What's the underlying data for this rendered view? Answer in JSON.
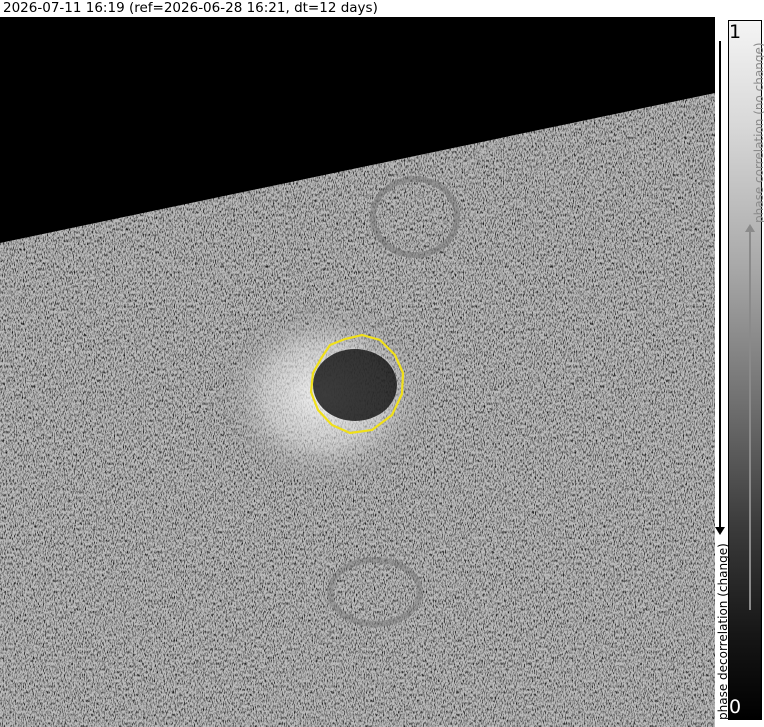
{
  "title": "2026-07-11 16:19 (ref=2026-06-28 16:21, dt=12 days)",
  "colorbar": {
    "max_label": "1",
    "min_label": "0",
    "high_label": "phase correlation (no change)",
    "low_label": "phase decorrelation (change)"
  },
  "colors": {
    "outline": "#f0e01a",
    "no_data": "#000000",
    "background": "#ffffff"
  }
}
